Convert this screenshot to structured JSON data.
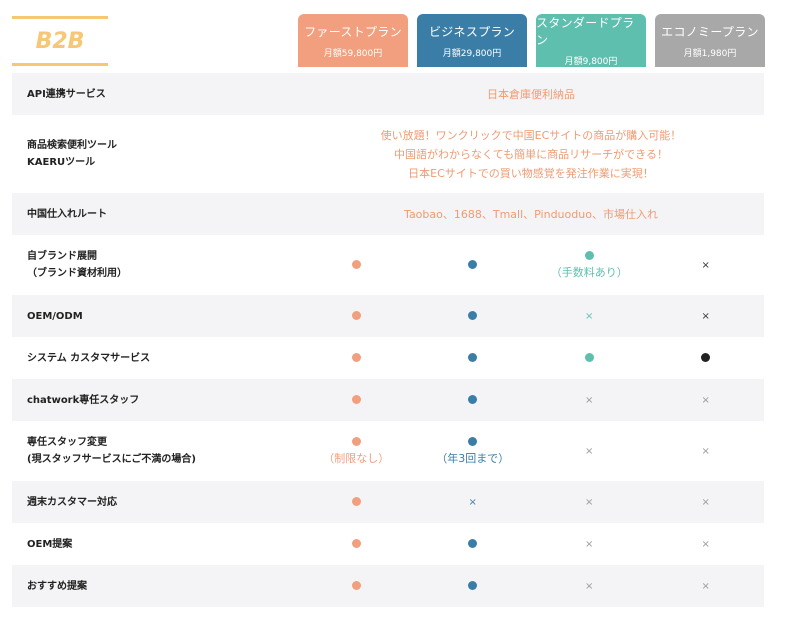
{
  "logo": "B2B",
  "plans": [
    {
      "name": "ファーストプラン",
      "price": "月額59,800円",
      "color": "#f19f7e"
    },
    {
      "name": "ビジネスプラン",
      "price": "月額29,800円",
      "color": "#3a7ea8"
    },
    {
      "name": "スタンダードプラン",
      "price": "月額9,800円",
      "color": "#5ebfae"
    },
    {
      "name": "エコノミープラン",
      "price": "月額1,980円",
      "color": "#a8a8a8"
    }
  ],
  "colors": {
    "first": "#f19f7e",
    "business": "#3a7ea8",
    "standard": "#5ebfae",
    "economy_dot": "#222222",
    "cross_standard": "#5ebfae",
    "cross_business": "#3a7ea8"
  },
  "rows": {
    "api": {
      "label": "API連携サービス",
      "value": "日本倉庫便利納品"
    },
    "kaeru": {
      "label1": "商品検索便利ツール",
      "label2": "KAERUツール",
      "line1": "使い放題！ワンクリックで中国ECサイトの商品が購入可能！",
      "line2": "中国語がわからなくても簡単に商品リサーチができる！",
      "line3": "日本ECサイトでの買い物感覚を発注作業に実現！"
    },
    "route": {
      "label": "中国仕入れルート",
      "value": "Taobao、1688、Tmall、Pinduoduo、市場仕入れ"
    },
    "brand": {
      "label1": "自ブランド展開",
      "label2": "（ブランド資材利用）",
      "standard_note": "（手数料あり）",
      "cross": "×"
    },
    "oem": {
      "label": "OEM/ODM",
      "cross": "×"
    },
    "system": {
      "label": "システム カスタマサービス"
    },
    "chatwork": {
      "label": "chatwork専任スタッフ",
      "cross": "×"
    },
    "staff_change": {
      "label1": "専任スタッフ変更",
      "label2": "(現スタッフサービスにご不満の場合)",
      "first_note": "（制限なし）",
      "business_note": "（年3回まで）",
      "cross": "×"
    },
    "weekend": {
      "label": "週末カスタマー対応",
      "cross": "×"
    },
    "oem_proposal": {
      "label": "OEM提案",
      "cross": "×"
    },
    "recommend": {
      "label": "おすすめ提案",
      "cross": "×"
    }
  }
}
